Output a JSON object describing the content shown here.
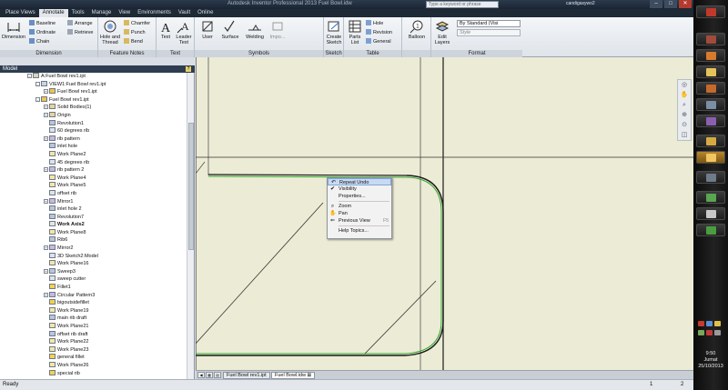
{
  "window": {
    "title": "Autodesk Inventor Professional 2013   Fuel Bowl.idw",
    "search_placeholder": "Type a keyword or phrase",
    "user": "candigasywo2",
    "minimize": "–",
    "maximize": "□",
    "close": "✕"
  },
  "tabs": [
    "Place Views",
    "Annotate",
    "Tools",
    "Manage",
    "View",
    "Environments",
    "Vault",
    "Online"
  ],
  "active_tab": "Annotate",
  "ribbon": {
    "dimension_panel": {
      "name": "Dimension",
      "dimension": "Dimension",
      "baseline": "Baseline",
      "ordinate": "Ordinate",
      "chain": "Chain",
      "arrange": "Arrange",
      "retrieve": "Retrieve"
    },
    "feature_notes_panel": {
      "name": "Feature Notes",
      "hole_thread": "Hole and Thread",
      "chamfer": "Chamfer",
      "punch": "Punch",
      "bend": "Bend"
    },
    "text_panel": {
      "name": "Text",
      "text": "Text",
      "leader_text": "Leader Text"
    },
    "symbols_panel": {
      "name": "Symbols",
      "user": "User",
      "surface": "Surface",
      "welding": "Welding",
      "import": "Impo..."
    },
    "sketch_panel": {
      "name": "Sketch",
      "create_sketch": "Create Sketch"
    },
    "table_panel": {
      "name": "Table",
      "parts_list": "Parts List",
      "hole": "Hole",
      "revision": "Revision",
      "general": "General"
    },
    "balloon_panel": {
      "balloon": "Balloon"
    },
    "format_panel": {
      "name": "Format",
      "edit_layers": "Edit Layers",
      "style_standard": "By Standard (Visi",
      "style": "Style"
    }
  },
  "browser": {
    "title": "Model",
    "help": "?",
    "tree": [
      {
        "label": "A:Fuel Bowl rev1.ipt",
        "level": 0,
        "exp": "-",
        "icon": "drawing"
      },
      {
        "label": "VIEW1:Fuel Bowl rev1.ipt",
        "level": 1,
        "exp": "-",
        "icon": "view"
      },
      {
        "label": "Fuel Bowl rev1.ipt",
        "level": 2,
        "exp": "+",
        "icon": "part"
      },
      {
        "label": "Fuel Bowl rev1.ipt",
        "level": 1,
        "exp": "-",
        "icon": "part"
      },
      {
        "label": "Solid Bodies(1)",
        "level": 2,
        "exp": "+",
        "icon": "folder"
      },
      {
        "label": "Origin",
        "level": 2,
        "exp": "+",
        "icon": "folder"
      },
      {
        "label": "Revolution1",
        "level": 2,
        "exp": "",
        "icon": "feature"
      },
      {
        "label": "60 degrees rib",
        "level": 2,
        "exp": "",
        "icon": "sketch"
      },
      {
        "label": "rib pattern",
        "level": 2,
        "exp": "+",
        "icon": "pattern"
      },
      {
        "label": "inlet hole",
        "level": 2,
        "exp": "",
        "icon": "feature"
      },
      {
        "label": "Work Plane2",
        "level": 2,
        "exp": "",
        "icon": "plane"
      },
      {
        "label": "45 degrees rib",
        "level": 2,
        "exp": "",
        "icon": "sketch"
      },
      {
        "label": "rib pattern 2",
        "level": 2,
        "exp": "+",
        "icon": "pattern"
      },
      {
        "label": "Work Plane4",
        "level": 2,
        "exp": "",
        "icon": "plane"
      },
      {
        "label": "Work Plane5",
        "level": 2,
        "exp": "",
        "icon": "plane"
      },
      {
        "label": "offset rib",
        "level": 2,
        "exp": "",
        "icon": "sketch"
      },
      {
        "label": "Mirror1",
        "level": 2,
        "exp": "+",
        "icon": "pattern"
      },
      {
        "label": "inlet hole 2",
        "level": 2,
        "exp": "",
        "icon": "feature"
      },
      {
        "label": "Revolution7",
        "level": 2,
        "exp": "",
        "icon": "feature"
      },
      {
        "label": "Work Axis2",
        "level": 2,
        "exp": "",
        "icon": "axis",
        "bold": true
      },
      {
        "label": "Work Plane8",
        "level": 2,
        "exp": "",
        "icon": "plane"
      },
      {
        "label": "Rib6",
        "level": 2,
        "exp": "",
        "icon": "feature"
      },
      {
        "label": "Mirror2",
        "level": 2,
        "exp": "+",
        "icon": "pattern"
      },
      {
        "label": "3D Sketch2:Model",
        "level": 2,
        "exp": "",
        "icon": "sketch"
      },
      {
        "label": "Work Plane16",
        "level": 2,
        "exp": "",
        "icon": "plane"
      },
      {
        "label": "Sweep3",
        "level": 2,
        "exp": "+",
        "icon": "feature"
      },
      {
        "label": "sweep cutter",
        "level": 2,
        "exp": "",
        "icon": "sketch"
      },
      {
        "label": "Fillet1",
        "level": 2,
        "exp": "",
        "icon": "fillet"
      },
      {
        "label": "Circular Pattern3",
        "level": 2,
        "exp": "+",
        "icon": "pattern"
      },
      {
        "label": "bigoutsidefillet",
        "level": 2,
        "exp": "",
        "icon": "fillet"
      },
      {
        "label": "Work Plane19",
        "level": 2,
        "exp": "",
        "icon": "plane"
      },
      {
        "label": "main rib draft",
        "level": 2,
        "exp": "",
        "icon": "feature"
      },
      {
        "label": "Work Plane21",
        "level": 2,
        "exp": "",
        "icon": "plane"
      },
      {
        "label": "offset rib draft",
        "level": 2,
        "exp": "",
        "icon": "feature"
      },
      {
        "label": "Work Plane22",
        "level": 2,
        "exp": "",
        "icon": "plane"
      },
      {
        "label": "Work Plane23",
        "level": 2,
        "exp": "",
        "icon": "plane"
      },
      {
        "label": "general fillet",
        "level": 2,
        "exp": "",
        "icon": "fillet"
      },
      {
        "label": "Work Plane26",
        "level": 2,
        "exp": "",
        "icon": "plane"
      },
      {
        "label": "special rib",
        "level": 2,
        "exp": "",
        "icon": "fillet"
      }
    ]
  },
  "context_menu": {
    "items": [
      {
        "label": "Repeat Undo",
        "icon": "undo",
        "highlight": true
      },
      {
        "label": "Visibility",
        "icon": "check"
      },
      {
        "label": "Properties...",
        "icon": ""
      },
      {
        "sep": true
      },
      {
        "label": "Zoom",
        "icon": "zoom"
      },
      {
        "label": "Pan",
        "icon": "pan"
      },
      {
        "label": "Previous View",
        "icon": "prev",
        "key": "F5"
      },
      {
        "sep": true
      },
      {
        "label": "Help Topics...",
        "icon": ""
      }
    ]
  },
  "doc_tabs": [
    "Fuel Bowl rev1.ipt",
    "Fuel Bowl.idw"
  ],
  "active_doc": "Fuel Bowl.idw",
  "status": {
    "text": "Ready",
    "count1": "1",
    "count2": "2"
  },
  "taskbar": {
    "time": "9:50",
    "day": "Jumat",
    "date": "25/10/2013"
  },
  "colors": {
    "canvas": "#ecebd5",
    "profile": "#2ea82e",
    "line": "#1a1a1a",
    "accent": "#c8daf3"
  }
}
